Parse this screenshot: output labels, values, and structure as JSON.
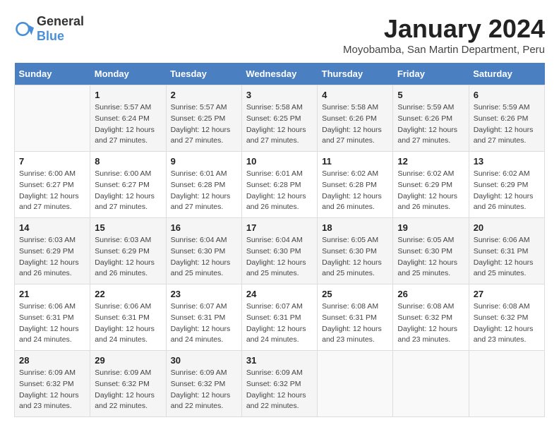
{
  "logo": {
    "text_general": "General",
    "text_blue": "Blue"
  },
  "title": "January 2024",
  "subtitle": "Moyobamba, San Martin Department, Peru",
  "headers": [
    "Sunday",
    "Monday",
    "Tuesday",
    "Wednesday",
    "Thursday",
    "Friday",
    "Saturday"
  ],
  "weeks": [
    [
      {
        "day": "",
        "info": ""
      },
      {
        "day": "1",
        "info": "Sunrise: 5:57 AM\nSunset: 6:24 PM\nDaylight: 12 hours\nand 27 minutes."
      },
      {
        "day": "2",
        "info": "Sunrise: 5:57 AM\nSunset: 6:25 PM\nDaylight: 12 hours\nand 27 minutes."
      },
      {
        "day": "3",
        "info": "Sunrise: 5:58 AM\nSunset: 6:25 PM\nDaylight: 12 hours\nand 27 minutes."
      },
      {
        "day": "4",
        "info": "Sunrise: 5:58 AM\nSunset: 6:26 PM\nDaylight: 12 hours\nand 27 minutes."
      },
      {
        "day": "5",
        "info": "Sunrise: 5:59 AM\nSunset: 6:26 PM\nDaylight: 12 hours\nand 27 minutes."
      },
      {
        "day": "6",
        "info": "Sunrise: 5:59 AM\nSunset: 6:26 PM\nDaylight: 12 hours\nand 27 minutes."
      }
    ],
    [
      {
        "day": "7",
        "info": "Sunrise: 6:00 AM\nSunset: 6:27 PM\nDaylight: 12 hours\nand 27 minutes."
      },
      {
        "day": "8",
        "info": "Sunrise: 6:00 AM\nSunset: 6:27 PM\nDaylight: 12 hours\nand 27 minutes."
      },
      {
        "day": "9",
        "info": "Sunrise: 6:01 AM\nSunset: 6:28 PM\nDaylight: 12 hours\nand 27 minutes."
      },
      {
        "day": "10",
        "info": "Sunrise: 6:01 AM\nSunset: 6:28 PM\nDaylight: 12 hours\nand 26 minutes."
      },
      {
        "day": "11",
        "info": "Sunrise: 6:02 AM\nSunset: 6:28 PM\nDaylight: 12 hours\nand 26 minutes."
      },
      {
        "day": "12",
        "info": "Sunrise: 6:02 AM\nSunset: 6:29 PM\nDaylight: 12 hours\nand 26 minutes."
      },
      {
        "day": "13",
        "info": "Sunrise: 6:02 AM\nSunset: 6:29 PM\nDaylight: 12 hours\nand 26 minutes."
      }
    ],
    [
      {
        "day": "14",
        "info": "Sunrise: 6:03 AM\nSunset: 6:29 PM\nDaylight: 12 hours\nand 26 minutes."
      },
      {
        "day": "15",
        "info": "Sunrise: 6:03 AM\nSunset: 6:29 PM\nDaylight: 12 hours\nand 26 minutes."
      },
      {
        "day": "16",
        "info": "Sunrise: 6:04 AM\nSunset: 6:30 PM\nDaylight: 12 hours\nand 25 minutes."
      },
      {
        "day": "17",
        "info": "Sunrise: 6:04 AM\nSunset: 6:30 PM\nDaylight: 12 hours\nand 25 minutes."
      },
      {
        "day": "18",
        "info": "Sunrise: 6:05 AM\nSunset: 6:30 PM\nDaylight: 12 hours\nand 25 minutes."
      },
      {
        "day": "19",
        "info": "Sunrise: 6:05 AM\nSunset: 6:30 PM\nDaylight: 12 hours\nand 25 minutes."
      },
      {
        "day": "20",
        "info": "Sunrise: 6:06 AM\nSunset: 6:31 PM\nDaylight: 12 hours\nand 25 minutes."
      }
    ],
    [
      {
        "day": "21",
        "info": "Sunrise: 6:06 AM\nSunset: 6:31 PM\nDaylight: 12 hours\nand 24 minutes."
      },
      {
        "day": "22",
        "info": "Sunrise: 6:06 AM\nSunset: 6:31 PM\nDaylight: 12 hours\nand 24 minutes."
      },
      {
        "day": "23",
        "info": "Sunrise: 6:07 AM\nSunset: 6:31 PM\nDaylight: 12 hours\nand 24 minutes."
      },
      {
        "day": "24",
        "info": "Sunrise: 6:07 AM\nSunset: 6:31 PM\nDaylight: 12 hours\nand 24 minutes."
      },
      {
        "day": "25",
        "info": "Sunrise: 6:08 AM\nSunset: 6:31 PM\nDaylight: 12 hours\nand 23 minutes."
      },
      {
        "day": "26",
        "info": "Sunrise: 6:08 AM\nSunset: 6:32 PM\nDaylight: 12 hours\nand 23 minutes."
      },
      {
        "day": "27",
        "info": "Sunrise: 6:08 AM\nSunset: 6:32 PM\nDaylight: 12 hours\nand 23 minutes."
      }
    ],
    [
      {
        "day": "28",
        "info": "Sunrise: 6:09 AM\nSunset: 6:32 PM\nDaylight: 12 hours\nand 23 minutes."
      },
      {
        "day": "29",
        "info": "Sunrise: 6:09 AM\nSunset: 6:32 PM\nDaylight: 12 hours\nand 22 minutes."
      },
      {
        "day": "30",
        "info": "Sunrise: 6:09 AM\nSunset: 6:32 PM\nDaylight: 12 hours\nand 22 minutes."
      },
      {
        "day": "31",
        "info": "Sunrise: 6:09 AM\nSunset: 6:32 PM\nDaylight: 12 hours\nand 22 minutes."
      },
      {
        "day": "",
        "info": ""
      },
      {
        "day": "",
        "info": ""
      },
      {
        "day": "",
        "info": ""
      }
    ]
  ]
}
